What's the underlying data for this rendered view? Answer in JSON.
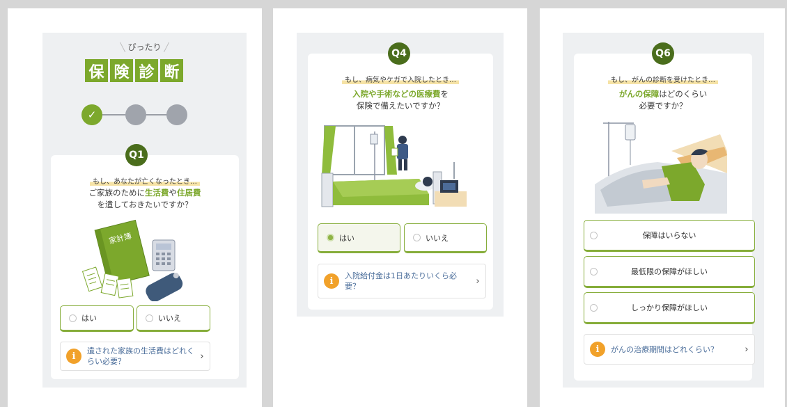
{
  "screen1": {
    "logo": {
      "small": "ぴったり",
      "chars": [
        "保",
        "険",
        "診",
        "断"
      ]
    },
    "steps_completed": 1,
    "steps_total": 3,
    "check_glyph": "✓",
    "badge": "Q1",
    "sub": "もし、あなたが亡くなったとき…",
    "q_pre": "ご家族のために",
    "q_hl1": "生活費",
    "q_mid": "や",
    "q_hl2": "住居費",
    "q_line2": "を遺しておきたいですか？",
    "notebook_title": "家計簿",
    "options": [
      "はい",
      "いいえ"
    ],
    "info_icon": "i",
    "info": "遺された家族の生活費はどれくらい必要？",
    "chev": "›"
  },
  "screen2": {
    "badge": "Q4",
    "sub": "もし、病気やケガで入院したとき…",
    "q_hl": "入院や手術などの医療費",
    "q_post": "を",
    "q_line2": "保険で備えたいですか？",
    "options": [
      "はい",
      "いいえ"
    ],
    "selected_index": 0,
    "info_icon": "i",
    "info": "入院給付金は1日あたりいくら必要？",
    "chev": "›"
  },
  "screen3": {
    "badge": "Q6",
    "sub": "もし、がんの診断を受けたとき…",
    "q_hl": "がんの保障",
    "q_post": "はどのくらい",
    "q_line2": "必要ですか？",
    "options": [
      "保障はいらない",
      "最低限の保障がほしい",
      "しっかり保障がほしい"
    ],
    "info_icon": "i",
    "info": "がんの治療期間はどれくらい？",
    "chev": "›"
  },
  "colors": {
    "accent": "#7ca82c",
    "badge": "#4a6d1c",
    "info_icon": "#f1a12a",
    "info_text": "#4a6d9a",
    "panel_bg": "#eef0f2"
  }
}
